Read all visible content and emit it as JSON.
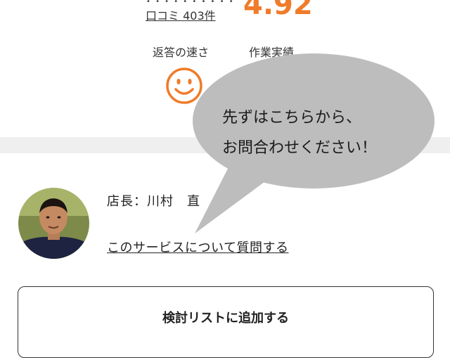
{
  "rating": {
    "reviews_text": "口コミ 403件",
    "score": "4.92"
  },
  "metrics": {
    "speed_label": "返答の速さ",
    "record_label": "作業実績",
    "speed_icon": "smile-icon"
  },
  "bubble": {
    "line1": "先ずはこちらから、",
    "line2": "お問合わせください！"
  },
  "manager": {
    "name_text": "店長：川村　直",
    "ask_link": "このサービスについて質問する"
  },
  "actions": {
    "add_to_list": "検討リストに追加する"
  },
  "colors": {
    "accent": "#f07b29",
    "bubble": "#bdbdbd"
  }
}
